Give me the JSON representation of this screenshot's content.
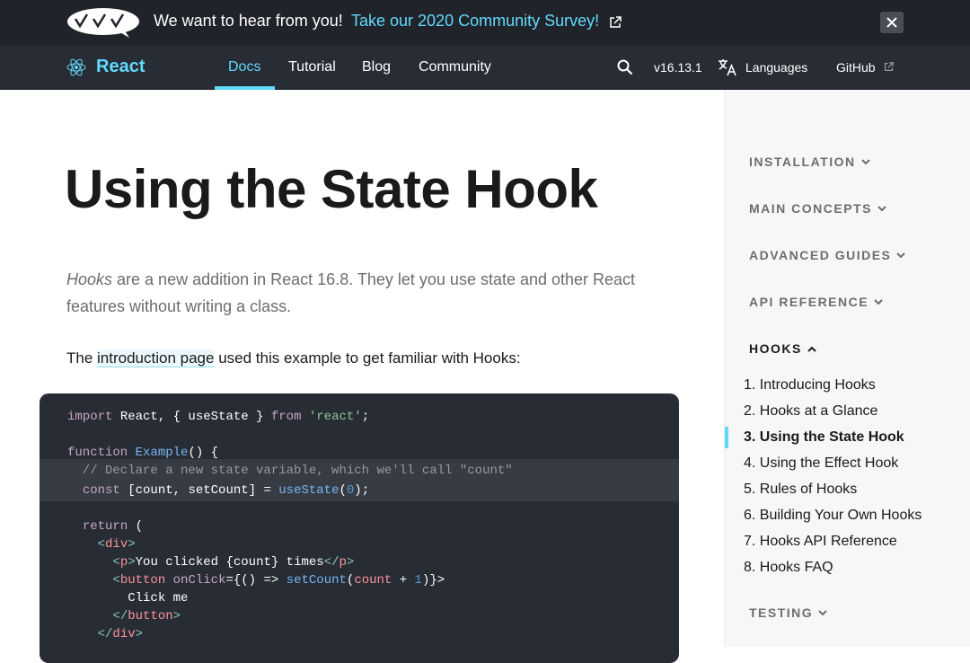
{
  "banner": {
    "text": "We want to hear from you!",
    "link": "Take our 2020 Community Survey!"
  },
  "nav": {
    "brand": "React",
    "links": [
      "Docs",
      "Tutorial",
      "Blog",
      "Community"
    ],
    "active": "Docs",
    "version": "v16.13.1",
    "languages": "Languages",
    "github": "GitHub"
  },
  "main": {
    "title": "Using the State Hook",
    "intro_em": "Hooks",
    "intro_rest": " are a new addition in React 16.8. They let you use state and other React features without writing a class.",
    "para_before": "The ",
    "para_link": "introduction page",
    "para_after": " used this example to get familiar with Hooks:",
    "code_lines": [
      "import React, { useState } from 'react';",
      "",
      "function Example() {",
      "  // Declare a new state variable, which we'll call \"count\"",
      "  const [count, setCount] = useState(0);",
      "",
      "  return (",
      "    <div>",
      "      <p>You clicked {count} times</p>",
      "      <button onClick={() => setCount(count + 1)}>",
      "        Click me",
      "      </button>",
      "    </div>"
    ]
  },
  "sidebar": {
    "sections": [
      "INSTALLATION",
      "MAIN CONCEPTS",
      "ADVANCED GUIDES",
      "API REFERENCE",
      "HOOKS",
      "TESTING"
    ],
    "open_section": "HOOKS",
    "hooks_items": [
      "1. Introducing Hooks",
      "2. Hooks at a Glance",
      "3. Using the State Hook",
      "4. Using the Effect Hook",
      "5. Rules of Hooks",
      "6. Building Your Own Hooks",
      "7. Hooks API Reference",
      "8. Hooks FAQ"
    ],
    "active_item": "3. Using the State Hook"
  },
  "colors": {
    "brand": "#61dafb",
    "nav_bg": "#282c34",
    "banner_bg": "#20232a",
    "sidebar_bg": "#f7f7f7"
  },
  "icons": [
    "survey-logo-icon",
    "external-link-icon",
    "close-icon",
    "react-logo-icon",
    "search-icon",
    "translate-icon",
    "chevron-down-icon",
    "chevron-up-icon"
  ]
}
